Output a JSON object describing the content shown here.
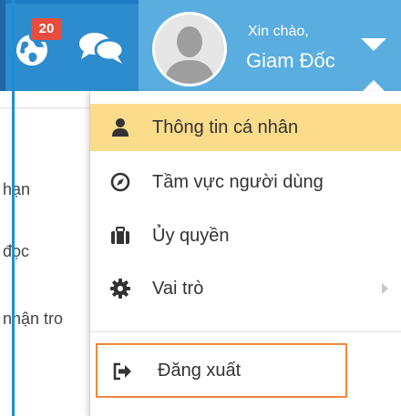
{
  "header": {
    "notifications": {
      "badge_count": "20",
      "icon": "globe-icon"
    },
    "messages": {
      "icon": "chat-icon"
    },
    "user": {
      "greeting": "Xin chào,",
      "name": "Giam Đốc",
      "avatar_icon": "user-avatar-icon",
      "menu_toggle_icon": "caret-down-icon"
    }
  },
  "background_list": {
    "items": [
      {
        "label": "hạn"
      },
      {
        "label": "đọc"
      },
      {
        "label": "nhận tro"
      }
    ]
  },
  "dropdown": {
    "items": [
      {
        "label": "Thông tin cá nhân",
        "icon": "user-icon",
        "active": true
      },
      {
        "label": "Tầm vực người dùng",
        "icon": "compass-icon",
        "active": false
      },
      {
        "label": "Ủy quyền",
        "icon": "briefcase-icon",
        "active": false
      },
      {
        "label": "Vai trò",
        "icon": "gear-icon",
        "active": false,
        "has_submenu": true
      }
    ],
    "logout": {
      "label": "Đăng xuất",
      "icon": "sign-out-icon"
    }
  },
  "colors": {
    "topbar": "#2d8ccd",
    "user_area": "#5aaddf",
    "active_item": "#fbdc8a",
    "badge": "#e74c3c",
    "logout_border": "#f0883b",
    "accent_line": "#1b8fd6"
  }
}
